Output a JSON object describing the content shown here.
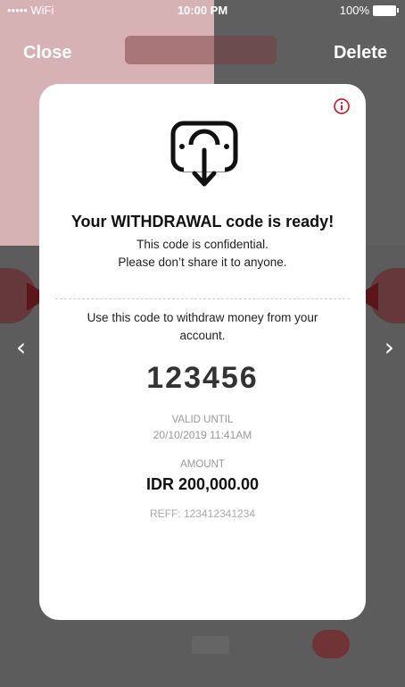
{
  "status_bar": {
    "carrier": "••••• WiFi",
    "time": "10:00 PM",
    "battery": "100%"
  },
  "nav": {
    "close_label": "Close",
    "delete_label": "Delete"
  },
  "card": {
    "title": "Your WITHDRAWAL code is ready!",
    "subtitle_line1": "This code is confidential.",
    "subtitle_line2": "Please don’t share it to anyone.",
    "instruction": "Use this code to withdraw money from your account.",
    "code": "123456",
    "valid_until_label": "VALID UNTIL",
    "valid_until_value": "20/10/2019 11:41AM",
    "amount_label": "AMOUNT",
    "amount_value": "IDR 200,000.00",
    "reference": "REFF: 123412341234"
  },
  "icons": {
    "info": "info-icon",
    "withdraw": "atm-withdraw-icon",
    "prev": "chevron-left-icon",
    "next": "chevron-right-icon"
  },
  "colors": {
    "accent": "#d0021b",
    "notch": "#5c1518",
    "overlay": "#5e5e5e"
  }
}
